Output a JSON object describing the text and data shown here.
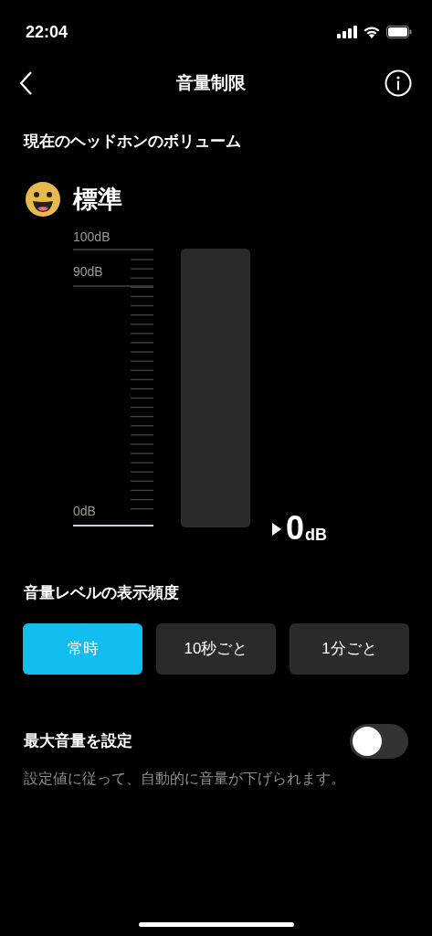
{
  "status_bar": {
    "time": "22:04"
  },
  "nav": {
    "title": "音量制限"
  },
  "current": {
    "label": "現在のヘッドホンのボリューム",
    "status": "標準"
  },
  "meter": {
    "scale_labels": [
      "100dB",
      "90dB",
      "0dB"
    ],
    "level": 0,
    "reading": "0",
    "unit": "dB"
  },
  "frequency": {
    "label": "音量レベルの表示頻度",
    "options": [
      {
        "label": "常時",
        "selected": true
      },
      {
        "label": "10秒ごと",
        "selected": false
      },
      {
        "label": "1分ごと",
        "selected": false
      }
    ]
  },
  "max_volume": {
    "label": "最大音量を設定",
    "on": false,
    "description": "設定値に従って、自動的に音量が下げられます。"
  }
}
